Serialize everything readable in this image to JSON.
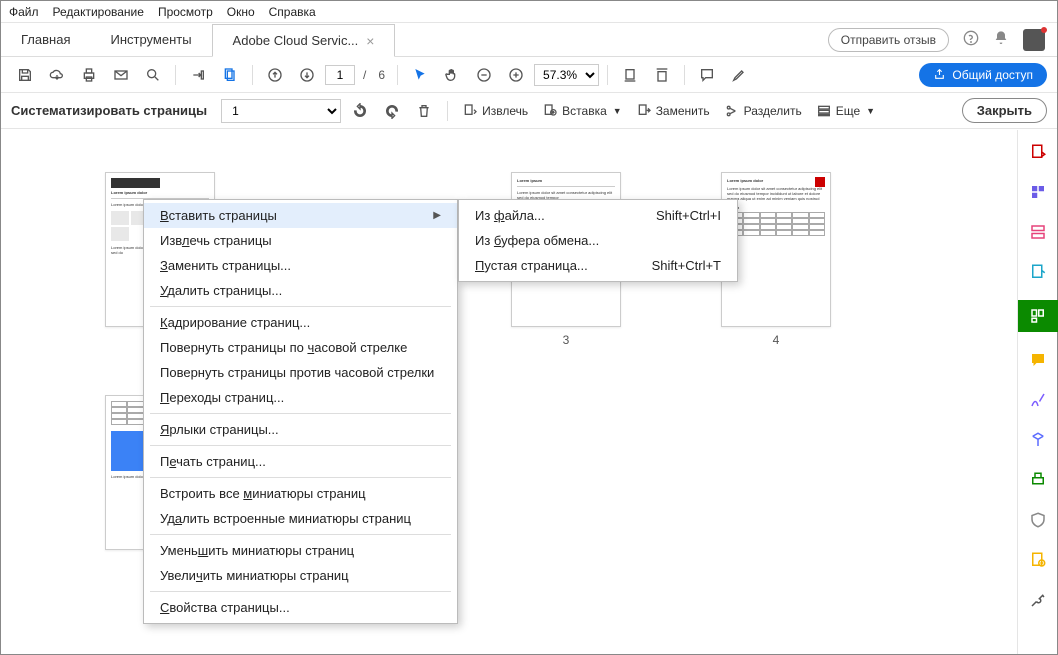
{
  "menubar": [
    "Файл",
    "Редактирование",
    "Просмотр",
    "Окно",
    "Справка"
  ],
  "tabs": {
    "home": "Главная",
    "tools": "Инструменты",
    "doc": "Adobe Cloud Servic...",
    "feedback": "Отправить отзыв"
  },
  "toolbar": {
    "page_current": "1",
    "page_sep": "/",
    "page_total": "6",
    "zoom": "57.3%",
    "share": "Общий доступ"
  },
  "subtool": {
    "title": "Систематизировать страницы",
    "range": "1",
    "extract": "Извлечь",
    "insert": "Вставка",
    "replace": "Заменить",
    "split": "Разделить",
    "more": "Еще",
    "close": "Закрыть"
  },
  "thumbs": {
    "p3": "3",
    "p4": "4"
  },
  "ctx": {
    "insert_pages": "Вставить страницы",
    "extract": "Извлечь страницы",
    "replace": "Заменить страницы...",
    "delete": "Удалить страницы...",
    "crop": "Кадрирование страниц...",
    "rotate_cw": "Повернуть страницы по часовой стрелке",
    "rotate_ccw": "Повернуть страницы против часовой стрелки",
    "transitions": "Переходы страниц...",
    "labels": "Ярлыки страницы...",
    "print": "Печать страниц...",
    "embed_all": "Встроить все миниатюры страниц",
    "remove_embedded": "Удалить встроенные миниатюры страниц",
    "reduce": "Уменьшить миниатюры страниц",
    "enlarge": "Увеличить миниатюры страниц",
    "props": "Свойства страницы..."
  },
  "submenu": {
    "from_file": "Из файла...",
    "from_clipboard": "Из буфера обмена...",
    "blank": "Пустая страница...",
    "sc1": "Shift+Ctrl+I",
    "sc2": "Shift+Ctrl+T"
  }
}
